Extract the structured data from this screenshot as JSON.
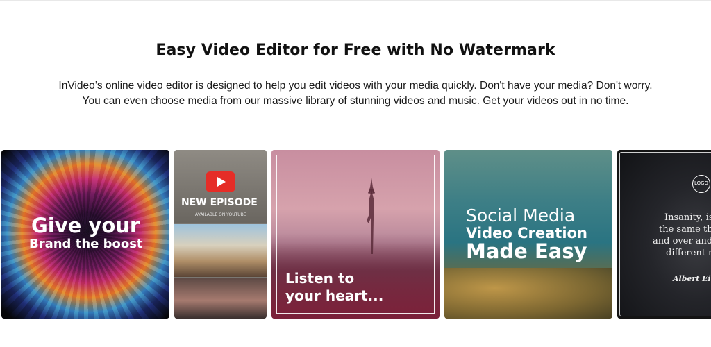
{
  "heading": "Easy Video Editor for Free with No Watermark",
  "description": "InVideo’s online video editor is designed to help you edit videos with your media quickly. Don't have your media? Don't worry. You can even choose media from our massive library of stunning videos and music. Get your videos out in no time.",
  "cards": [
    {
      "line1": "Give your",
      "line2": "Brand the boost"
    },
    {
      "title": "NEW EPISODE",
      "subtitle": "AVAILABLE ON YOUTUBE"
    },
    {
      "line1": "Listen to",
      "line2": "your heart..."
    },
    {
      "line1": "Social Media",
      "line2": "Video Creation",
      "line3": "Made Easy"
    },
    {
      "logo": "LOGO",
      "quote_lines": [
        "Insanity, is",
        "the same thi",
        "and over and c",
        "different re"
      ],
      "author": "Albert Ein"
    }
  ],
  "colors": {
    "youtube_red": "#e52d27",
    "heading": "#111111"
  }
}
